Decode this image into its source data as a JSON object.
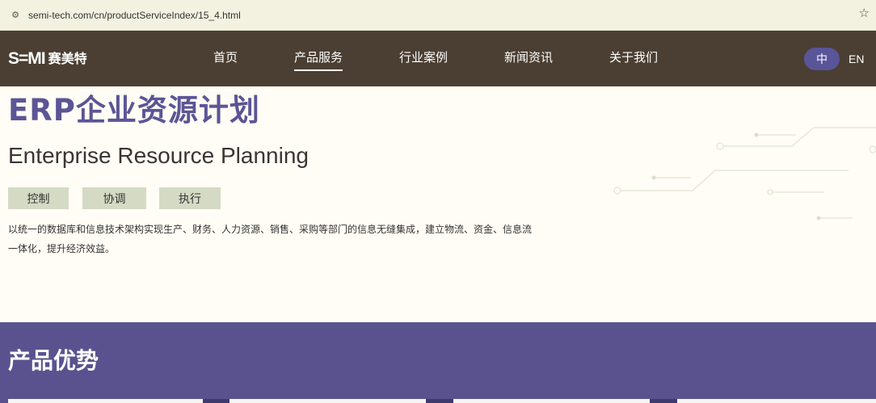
{
  "browser": {
    "url": "semi-tech.com/cn/productServiceIndex/15_4.html"
  },
  "nav": {
    "logo_mark": "S=MI",
    "logo_cn": "赛美特",
    "items": [
      {
        "label": "首页"
      },
      {
        "label": "产品服务"
      },
      {
        "label": "行业案例"
      },
      {
        "label": "新闻资讯"
      },
      {
        "label": "关于我们"
      }
    ],
    "active_index": 1,
    "lang_cn": "中",
    "lang_en": "EN"
  },
  "hero": {
    "title_cn": "ERP企业资源计划",
    "title_en": "Enterprise Resource Planning",
    "tags": [
      "控制",
      "协调",
      "执行"
    ],
    "description_line1": "以统一的数据库和信息技术架构实现生产、财务、人力资源、销售、采购等部门的信息无缝集成，建立物流、资金、信息流",
    "description_line2": "一体化，提升经济效益。"
  },
  "advantages": {
    "title": "产品优势"
  },
  "colors": {
    "nav_bg": "#4b3f33",
    "accent_purple": "#5a528f",
    "title_purple": "#5c5595",
    "tag_bg": "#d5dac4",
    "page_bg": "#fffdf5"
  },
  "icons": {
    "site_info": "site-settings-icon",
    "bookmark": "star-icon"
  }
}
